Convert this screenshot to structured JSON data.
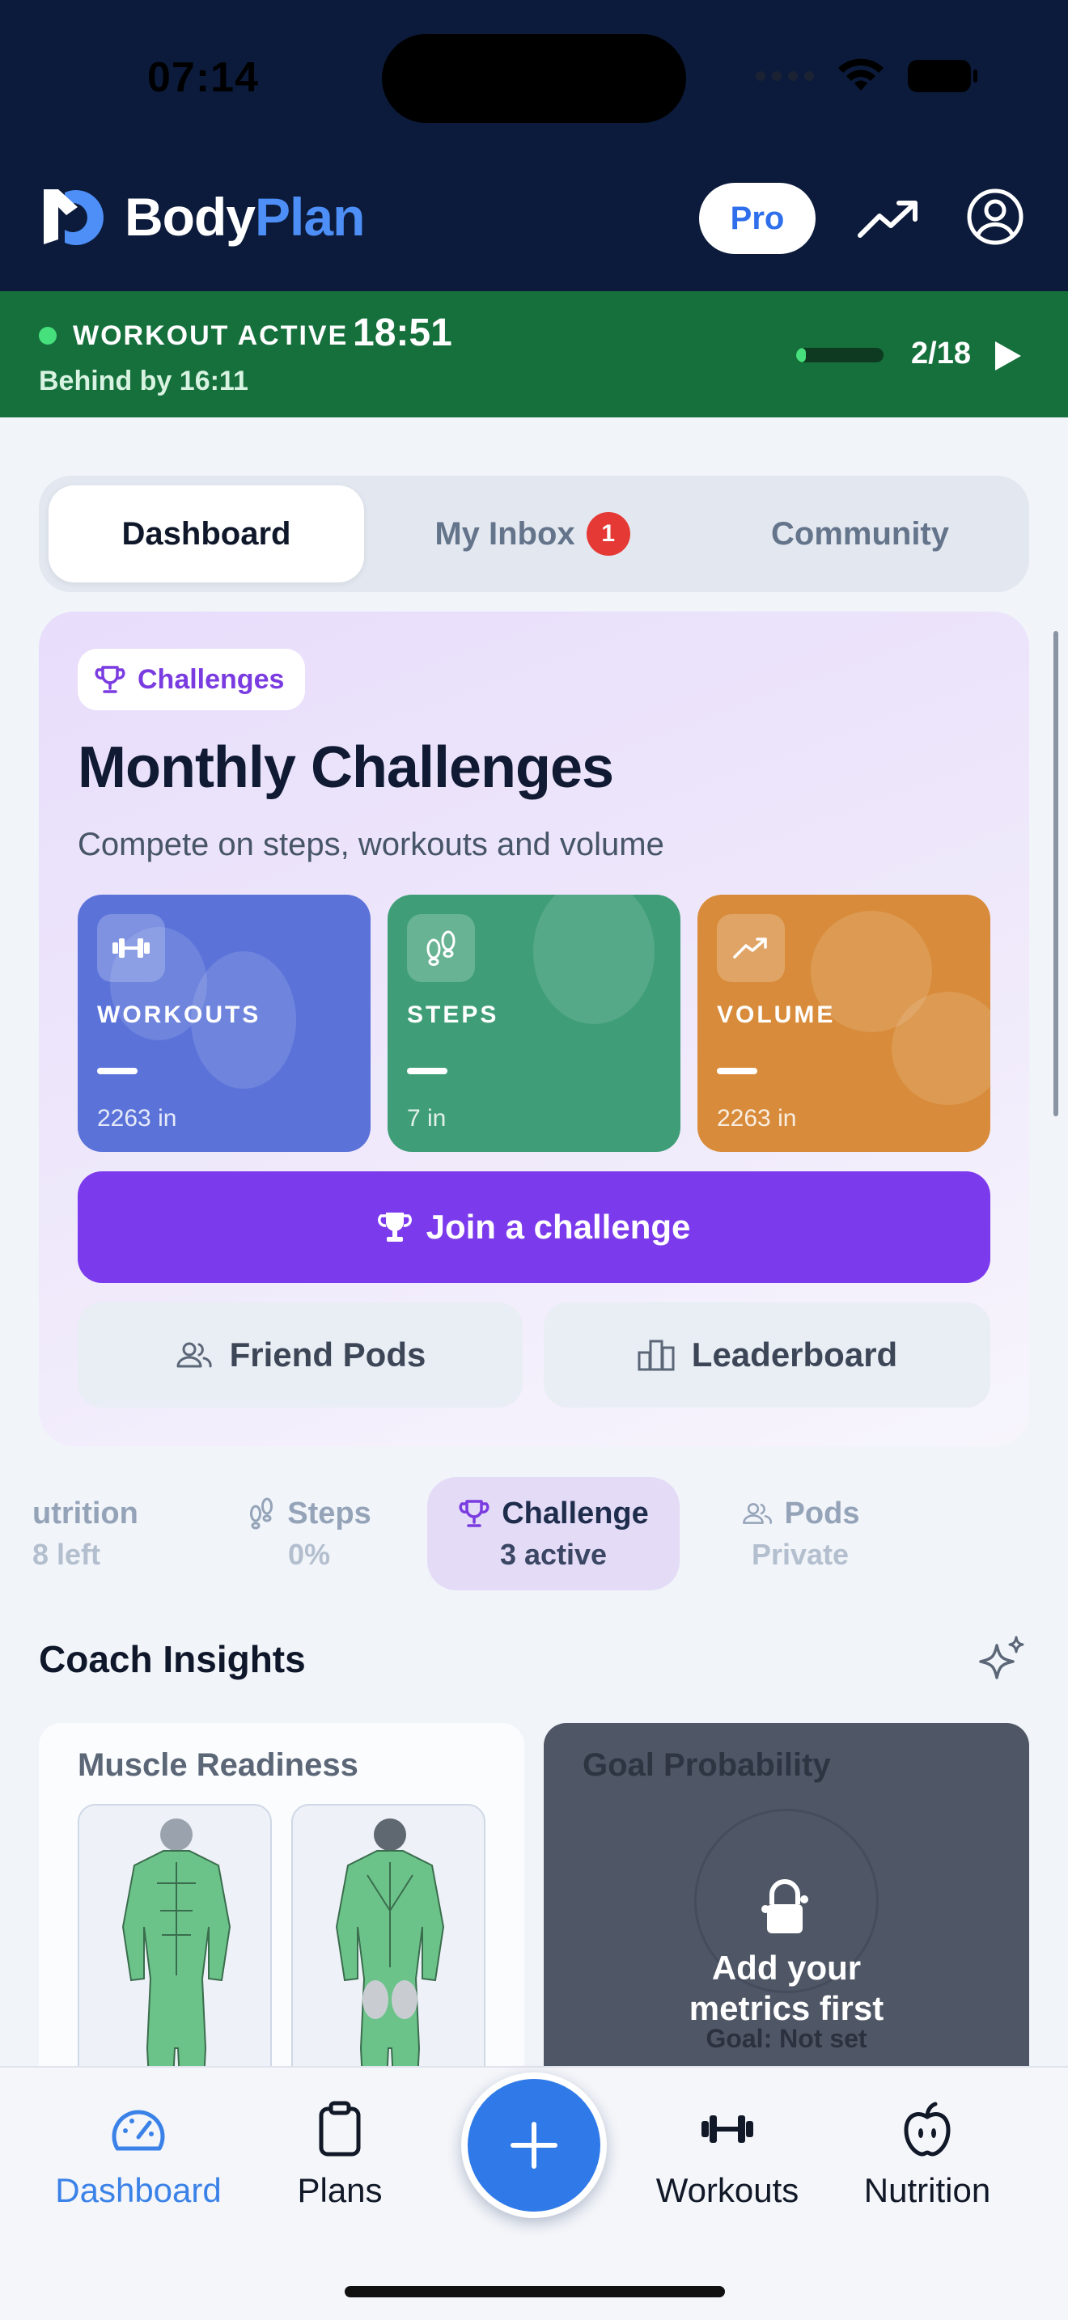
{
  "status_bar": {
    "time": "07:14"
  },
  "header": {
    "brand_part1": "Body",
    "brand_part2": "Plan",
    "pro_label": "Pro",
    "colors": {
      "background": "#0c1b3b",
      "brand_accent": "#4d8ff7"
    }
  },
  "workout_banner": {
    "label": "WORKOUT ACTIVE",
    "elapsed": "18:51",
    "behind": "Behind by 16:11",
    "progress_fraction": 0.11,
    "count": "2/18",
    "color": "#16703c"
  },
  "tabs": [
    {
      "label": "Dashboard",
      "active": true
    },
    {
      "label": "My Inbox",
      "badge": "1"
    },
    {
      "label": "Community"
    }
  ],
  "challenges": {
    "chip": "Challenges",
    "title": "Monthly Challenges",
    "subtitle": "Compete on steps, workouts and volume",
    "tiles": [
      {
        "name": "WORKOUTS",
        "value": "—",
        "unit": "2263 in",
        "icon": "dumbbell-icon",
        "color": "#5b73d9"
      },
      {
        "name": "STEPS",
        "value": "—",
        "unit": "7 in",
        "icon": "footsteps-icon",
        "color": "#3f9e78"
      },
      {
        "name": "VOLUME",
        "value": "—",
        "unit": "2263 in",
        "icon": "trend-up-icon",
        "color": "#d88c3b"
      }
    ],
    "join_label": "Join a challenge",
    "friend_pods_label": "Friend Pods",
    "leaderboard_label": "Leaderboard",
    "accent": "#7c3aed"
  },
  "stats": [
    {
      "label": "utrition",
      "sub": "8 left"
    },
    {
      "label": "Steps",
      "sub": "0%"
    },
    {
      "label": "Challenge",
      "sub": "3 active",
      "active": true
    },
    {
      "label": "Pods",
      "sub": "Private"
    }
  ],
  "coach": {
    "title": "Coach Insights",
    "muscle_readiness": "Muscle Readiness",
    "goal_probability": "Goal Probability",
    "goal_message_line1": "Add your",
    "goal_message_line2": "metrics first",
    "goal_status": "Goal: Not set"
  },
  "bottom_nav": [
    {
      "label": "Dashboard",
      "active": true
    },
    {
      "label": "Plans"
    },
    {
      "label": "Workouts"
    },
    {
      "label": "Nutrition"
    }
  ]
}
